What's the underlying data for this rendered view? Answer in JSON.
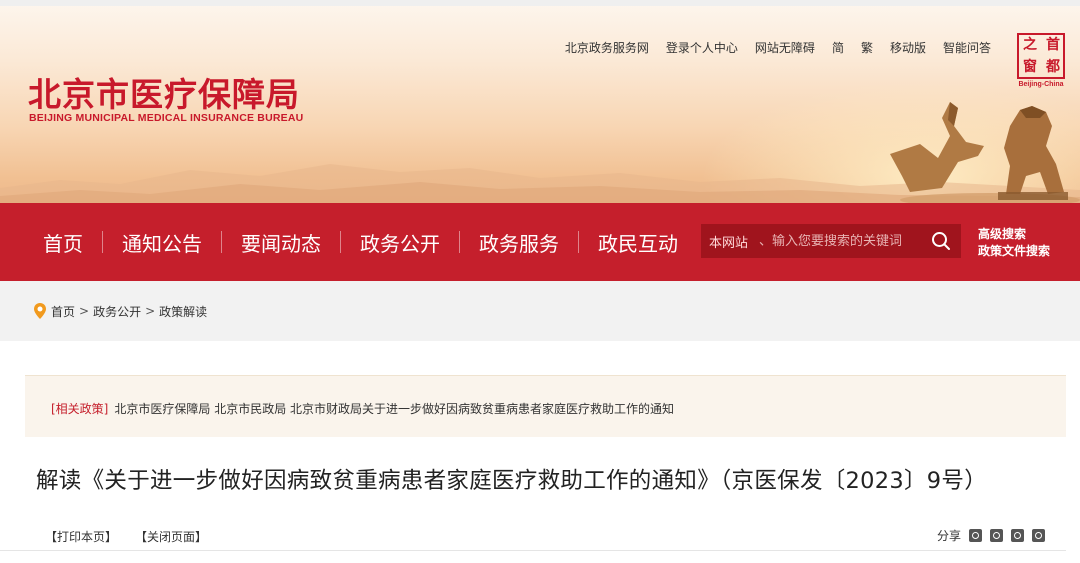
{
  "header": {
    "logo_cn": "北京市医疗保障局",
    "logo_en": "BEIJING MUNICIPAL MEDICAL INSURANCE BUREAU",
    "top_links": [
      "北京政务服务网",
      "登录个人中心",
      "网站无障碍",
      "简",
      "繁",
      "移动版",
      "智能问答"
    ],
    "seal": {
      "chars": [
        "之",
        "首",
        "窗",
        "都"
      ],
      "caption": "Beijing-China"
    }
  },
  "nav": {
    "items": [
      "首页",
      "通知公告",
      "要闻动态",
      "政务公开",
      "政务服务",
      "政民互动"
    ]
  },
  "search": {
    "scope": "本网站",
    "placeholder": "、输入您要搜索的关键词",
    "advanced": "高级搜索",
    "policy_search": "政策文件搜索"
  },
  "breadcrumb": [
    "首页",
    "政务公开",
    "政策解读"
  ],
  "breadcrumb_separator": ">",
  "related": {
    "tag": "[相关政策]",
    "text": "北京市医疗保障局 北京市民政局 北京市财政局关于进一步做好因病致贫重病患者家庭医疗救助工作的通知"
  },
  "article": {
    "title": "解读《关于进一步做好因病致贫重病患者家庭医疗救助工作的通知》（京医保发〔2023〕9号）",
    "print": "【打印本页】",
    "close": "【关闭页面】",
    "share": "分享"
  },
  "colors": {
    "brand_red": "#c51f2c",
    "search_bg": "#a0141d"
  }
}
